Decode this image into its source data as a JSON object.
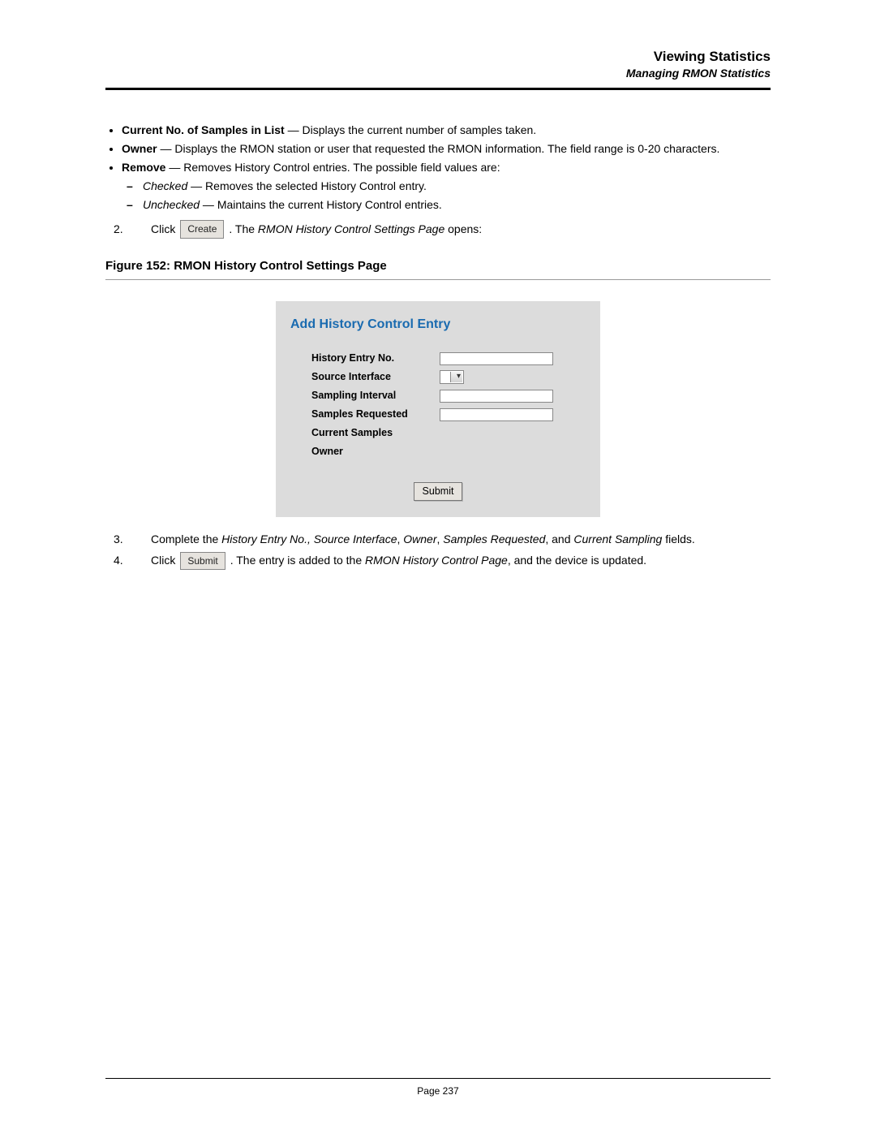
{
  "header": {
    "title": "Viewing Statistics",
    "subtitle": "Managing RMON Statistics"
  },
  "bullets": {
    "b1_bold": "Current No. of Samples in List",
    "b1_rest": " — Displays the current number of samples taken.",
    "b2_bold": "Owner",
    "b2_rest": " — Displays the RMON station or user that requested the RMON information. The field range is 0-20 characters.",
    "b3_bold": "Remove",
    "b3_rest": " — Removes History Control entries. The possible field values are:",
    "s1_em": "Checked",
    "s1_rest": " — Removes the selected History Control entry.",
    "s2_em": "Unchecked",
    "s2_rest": " — Maintains the current History Control entries."
  },
  "step2": {
    "num": "2.",
    "pre": "Click",
    "btn": "Create",
    "post_a": ". The ",
    "post_em": "RMON History Control Settings Page",
    "post_b": " opens:"
  },
  "figure": {
    "caption": "Figure 152: RMON History Control Settings Page"
  },
  "dialog": {
    "title": "Add History Control Entry",
    "labels": {
      "entry_no": "History Entry No.",
      "source_iface": "Source Interface",
      "sampling_interval": "Sampling Interval",
      "samples_requested": "Samples Requested",
      "current_samples": "Current Samples",
      "owner": "Owner"
    },
    "submit": "Submit"
  },
  "step3": {
    "num": "3.",
    "pre": "Complete the ",
    "f1": "History Entry No., Source Interface",
    "c1": ", ",
    "f2": "Owner",
    "c2": ", ",
    "f3": "Samples Requested",
    "c3": ", and ",
    "f4": "Current Sampling",
    "post": " fields."
  },
  "step4": {
    "num": "4.",
    "pre": "Click",
    "btn": "Submit",
    "post_a": ". The entry is added to the ",
    "post_em": "RMON History Control Page",
    "post_b": ", and the device is updated."
  },
  "footer": {
    "text": "Page 237"
  }
}
